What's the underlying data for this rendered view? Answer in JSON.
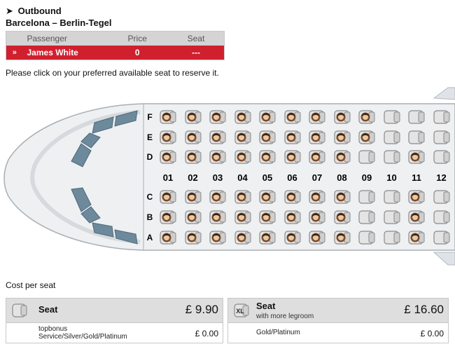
{
  "flight": {
    "direction": "Outbound",
    "route": "Barcelona – Berlin-Tegel"
  },
  "passengers": {
    "headers": [
      "Passenger",
      "Price",
      "Seat"
    ],
    "rows": [
      {
        "arrow": "»",
        "name": "James White",
        "price": "0",
        "seat": "---"
      }
    ]
  },
  "instruction": "Please click on your preferred available seat to reserve it.",
  "seatmap": {
    "rows_top": [
      "F",
      "E",
      "D"
    ],
    "rows_bottom": [
      "C",
      "B",
      "A"
    ],
    "columns": [
      "01",
      "02",
      "03",
      "04",
      "05",
      "06",
      "07",
      "08",
      "09",
      "10",
      "11",
      "12"
    ],
    "occupied": {
      "F": [
        1,
        2,
        3,
        4,
        5,
        6,
        7,
        8,
        9
      ],
      "E": [
        1,
        2,
        3,
        4,
        5,
        6,
        7,
        8,
        9
      ],
      "D": [
        1,
        2,
        3,
        4,
        5,
        6,
        7,
        8,
        11
      ],
      "C": [
        1,
        2,
        3,
        4,
        5,
        6,
        7,
        8,
        11
      ],
      "B": [
        1,
        2,
        3,
        4,
        5,
        6,
        7,
        8,
        11
      ],
      "A": [
        1,
        2,
        3,
        4,
        5,
        6,
        7,
        8,
        11
      ]
    },
    "colors": {
      "seat_free": "#e4e4e4",
      "seat_border": "#8a8a8a",
      "occupant": "#7a4a2a",
      "fuselage": "#eef0f2"
    }
  },
  "cost": {
    "title": "Cost per seat",
    "cards": [
      {
        "icon": "seat-icon",
        "name": "Seat",
        "subtitle": "",
        "price": "£ 9.90",
        "tier_label": "topbonus\nService/Silver/Gold/Platinum",
        "tier_price": "£ 0.00"
      },
      {
        "icon": "xl-seat-icon",
        "icon_text": "XL",
        "name": "Seat",
        "subtitle": "with more legroom",
        "price": "£ 16.60",
        "tier_label": "Gold/Platinum",
        "tier_price": "£ 0.00"
      }
    ]
  }
}
